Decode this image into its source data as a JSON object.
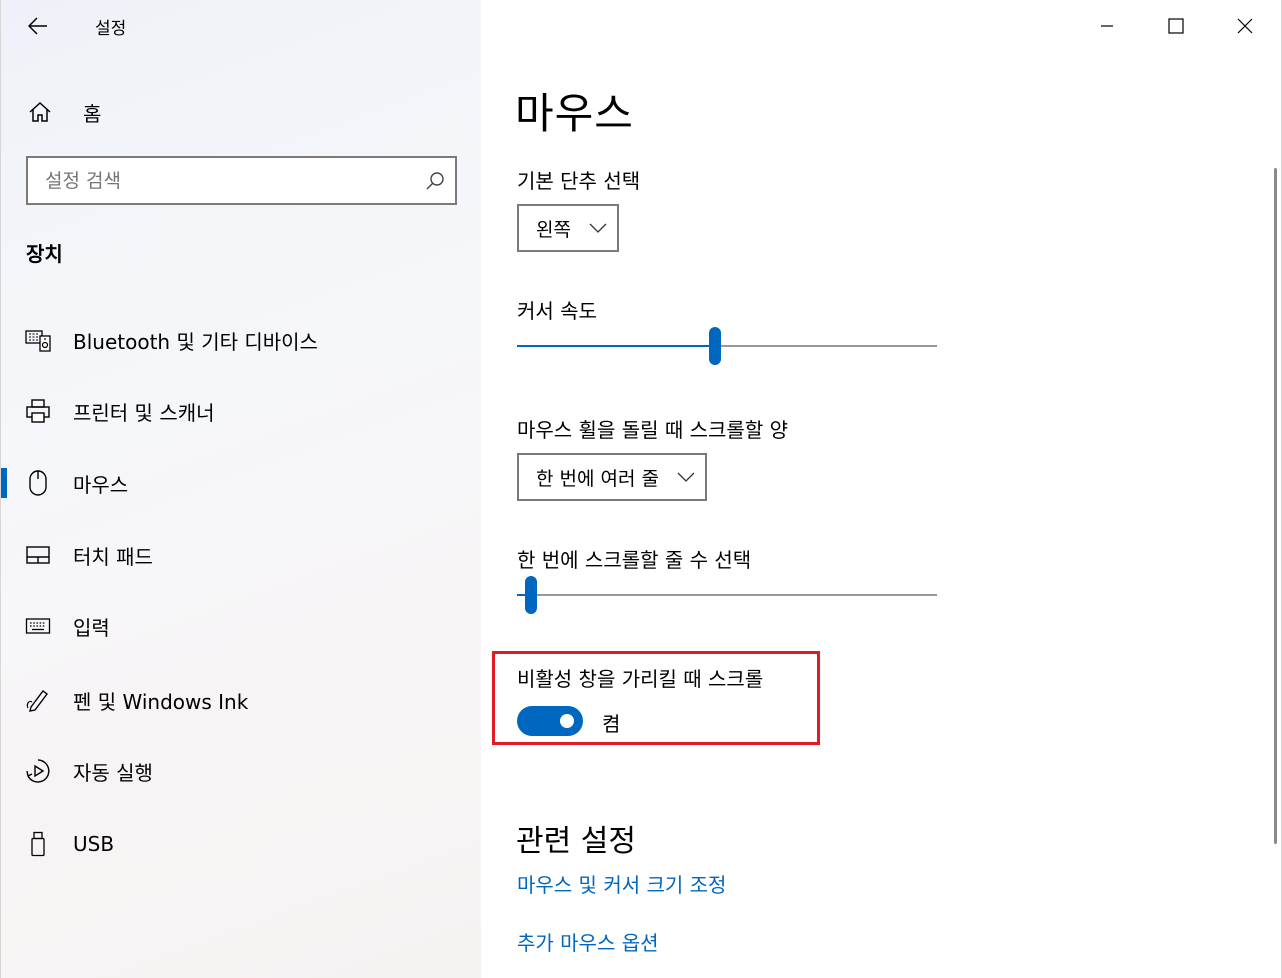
{
  "window": {
    "title": "설정",
    "controls": {
      "minimize": "minimize-icon",
      "maximize": "maximize-icon",
      "close": "close-icon"
    }
  },
  "sidebar": {
    "home_label": "홈",
    "search": {
      "placeholder": "설정 검색",
      "value": ""
    },
    "section_title": "장치",
    "items": [
      {
        "label": "Bluetooth 및 기타 디바이스",
        "icon": "bluetooth-devices-icon",
        "selected": false
      },
      {
        "label": "프린터 및 스캐너",
        "icon": "printer-icon",
        "selected": false
      },
      {
        "label": "마우스",
        "icon": "mouse-icon",
        "selected": true
      },
      {
        "label": "터치 패드",
        "icon": "touchpad-icon",
        "selected": false
      },
      {
        "label": "입력",
        "icon": "keyboard-icon",
        "selected": false
      },
      {
        "label": "펜 및 Windows Ink",
        "icon": "pen-icon",
        "selected": false
      },
      {
        "label": "자동 실행",
        "icon": "autoplay-icon",
        "selected": false
      },
      {
        "label": "USB",
        "icon": "usb-icon",
        "selected": false
      }
    ]
  },
  "main": {
    "title": "마우스",
    "primary_button": {
      "label": "기본 단추 선택",
      "value": "왼쪽"
    },
    "cursor_speed": {
      "label": "커서 속도",
      "value_fraction": 0.47
    },
    "wheel_scroll": {
      "label": "마우스 휠을 돌릴 때 스크롤할 양",
      "value": "한 번에 여러 줄"
    },
    "lines_per_scroll": {
      "label": "한 번에 스크롤할 줄 수 선택",
      "value_fraction": 0.02
    },
    "inactive_scroll": {
      "label": "비활성 창을 가리킬 때 스크롤",
      "state": "켬",
      "on": true
    },
    "related": {
      "title": "관련 설정",
      "links": [
        "마우스 및 커서 크기 조정",
        "추가 마우스 옵션"
      ]
    }
  },
  "colors": {
    "accent": "#0067c0",
    "highlight_border": "#e01b24"
  }
}
